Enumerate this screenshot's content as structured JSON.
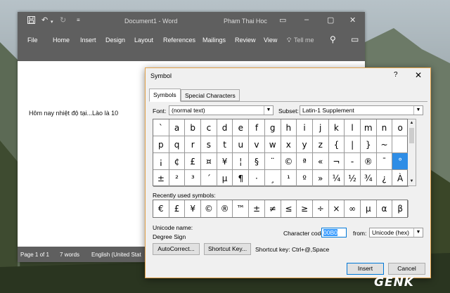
{
  "word": {
    "title_doc": "Document1 - Word",
    "user": "Pham Thai Hoc",
    "menu": [
      "File",
      "Home",
      "Insert",
      "Design",
      "Layout",
      "References",
      "Mailings",
      "Review",
      "View"
    ],
    "tell_me": "Tell me",
    "doc_text": "Hôm nay nhiệt độ tại...Lào là 10",
    "status": {
      "page": "Page 1 of 1",
      "words": "7 words",
      "lang": "English (United Stat"
    }
  },
  "dialog": {
    "title": "Symbol",
    "help": "?",
    "tabs": {
      "symbols": "Symbols",
      "special": "Special Characters"
    },
    "font_label": "Font:",
    "font_value": "(normal text)",
    "subset_label": "Subset:",
    "subset_value": "Latin-1 Supplement",
    "grid": [
      [
        "`",
        "a",
        "b",
        "c",
        "d",
        "e",
        "f",
        "g",
        "h",
        "i",
        "j",
        "k",
        "l",
        "m",
        "n",
        "o"
      ],
      [
        "p",
        "q",
        "r",
        "s",
        "t",
        "u",
        "v",
        "w",
        "x",
        "y",
        "z",
        "{",
        "|",
        "}",
        "~",
        ""
      ],
      [
        "¡",
        "¢",
        "£",
        "¤",
        "¥",
        "¦",
        "§",
        "¨",
        "©",
        "ª",
        "«",
        "¬",
        "-",
        "®",
        "¯",
        "°"
      ],
      [
        "±",
        "²",
        "³",
        "´",
        "µ",
        "¶",
        "·",
        "¸",
        "¹",
        "º",
        "»",
        "¼",
        "½",
        "¾",
        "¿",
        "À"
      ]
    ],
    "selected": "°",
    "recent_label": "Recently used symbols:",
    "recent": [
      "€",
      "£",
      "¥",
      "©",
      "®",
      "™",
      "±",
      "≠",
      "≤",
      "≥",
      "÷",
      "×",
      "∞",
      "µ",
      "α",
      "β"
    ],
    "unicode_name_label": "Unicode name:",
    "unicode_name": "Degree Sign",
    "char_code_label": "Character code:",
    "char_code": "00B0",
    "from_label": "from:",
    "from_value": "Unicode (hex)",
    "autocorrect": "AutoCorrect...",
    "shortcut_key_btn": "Shortcut Key...",
    "shortcut_key_text": "Shortcut key: Ctrl+@,Space",
    "insert": "Insert",
    "cancel": "Cancel"
  },
  "watermark": "GENK"
}
